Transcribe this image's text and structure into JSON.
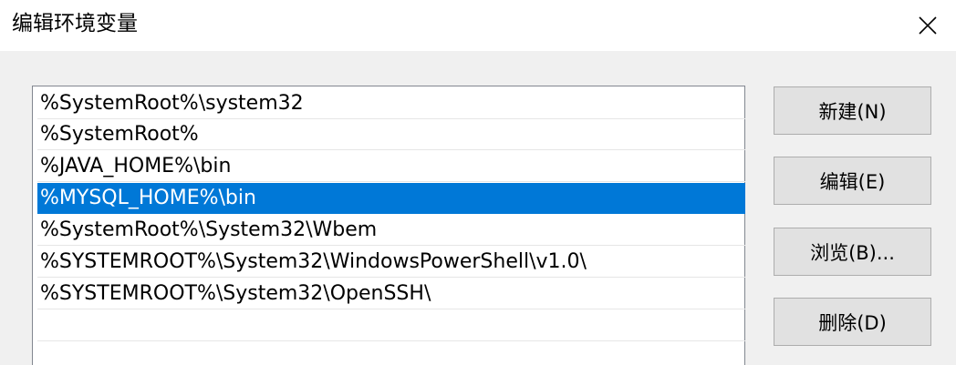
{
  "window": {
    "title": "编辑环境变量"
  },
  "path_list": {
    "items": [
      {
        "label": "%SystemRoot%\\system32",
        "selected": false
      },
      {
        "label": "%SystemRoot%",
        "selected": false
      },
      {
        "label": "%JAVA_HOME%\\bin",
        "selected": false
      },
      {
        "label": "%MYSQL_HOME%\\bin",
        "selected": true
      },
      {
        "label": "%SystemRoot%\\System32\\Wbem",
        "selected": false
      },
      {
        "label": "%SYSTEMROOT%\\System32\\WindowsPowerShell\\v1.0\\",
        "selected": false
      },
      {
        "label": "%SYSTEMROOT%\\System32\\OpenSSH\\",
        "selected": false
      },
      {
        "label": "",
        "selected": false
      }
    ]
  },
  "buttons": {
    "new_label": "新建(N)",
    "edit_label": "编辑(E)",
    "browse_label": "浏览(B)...",
    "delete_label": "删除(D)"
  },
  "colors": {
    "selection": "#0078d7",
    "title_bar": "#ffffff",
    "dialog_bg": "#f0f0f0"
  }
}
